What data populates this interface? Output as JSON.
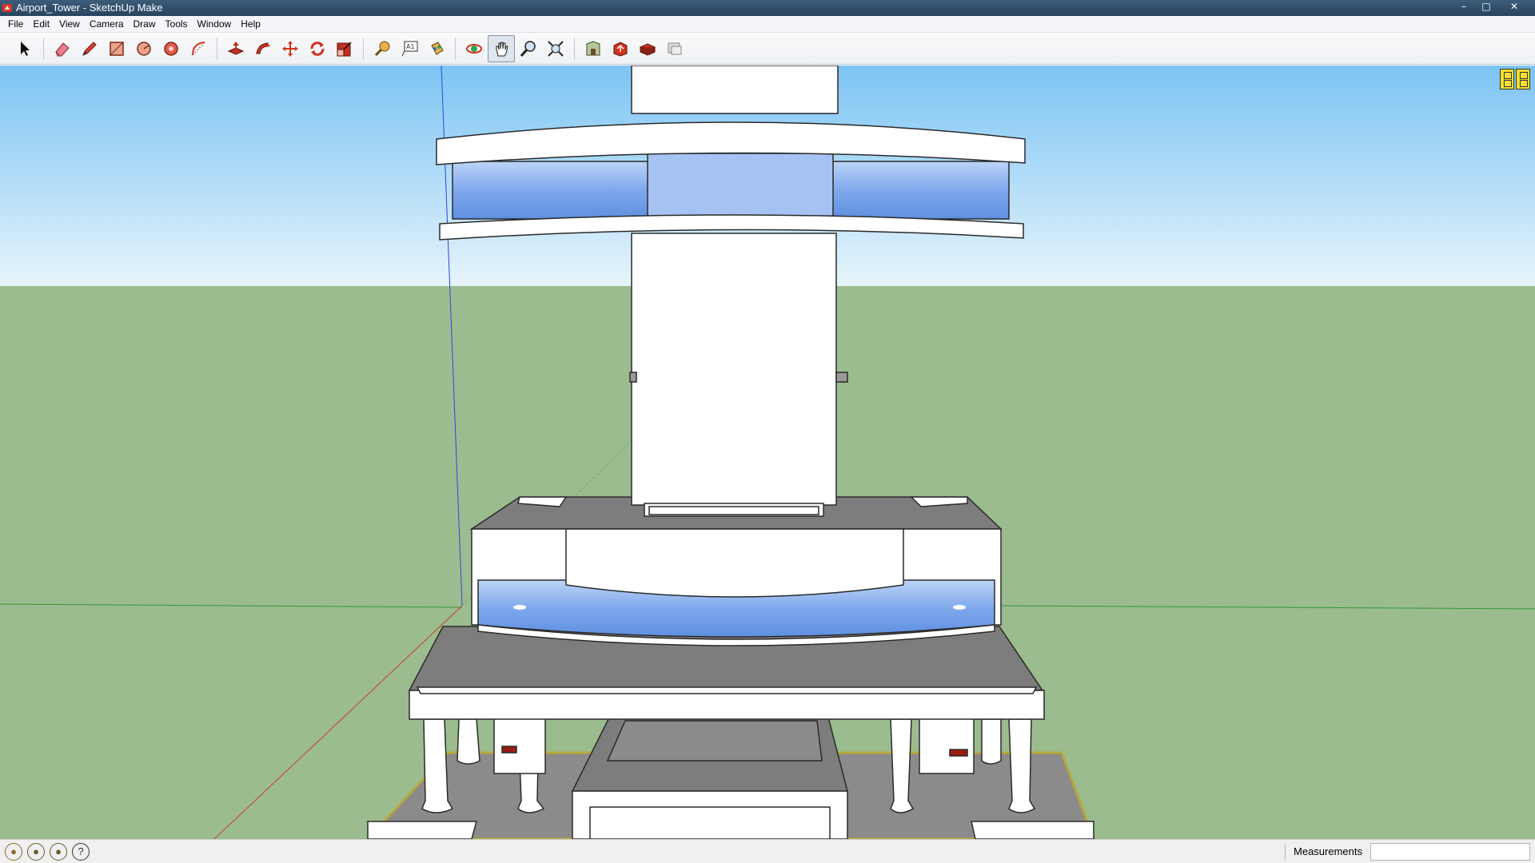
{
  "window": {
    "title": "Airport_Tower - SketchUp Make",
    "minimize": "–",
    "maximize": "□",
    "close": "✕"
  },
  "menu": [
    "File",
    "Edit",
    "View",
    "Camera",
    "Draw",
    "Tools",
    "Window",
    "Help"
  ],
  "toolbar": {
    "tools": [
      {
        "name": "select-tool",
        "icon": "arrow-icon"
      },
      {
        "name": "eraser-tool",
        "icon": "eraser-icon"
      },
      {
        "name": "line-tool",
        "icon": "pencil-icon"
      },
      {
        "name": "rectangle-tool",
        "icon": "rectangle-icon"
      },
      {
        "name": "circle-tool",
        "icon": "circle-icon"
      },
      {
        "name": "polygon-tool",
        "icon": "polygon-icon"
      },
      {
        "name": "arc-tool",
        "icon": "arc-icon"
      },
      {
        "name": "push-pull-tool",
        "icon": "push-pull-icon"
      },
      {
        "name": "follow-me-tool",
        "icon": "follow-me-icon"
      },
      {
        "name": "move-tool",
        "icon": "move-icon"
      },
      {
        "name": "rotate-tool",
        "icon": "rotate-icon"
      },
      {
        "name": "scale-tool",
        "icon": "scale-icon"
      },
      {
        "name": "tape-measure-tool",
        "icon": "tape-measure-icon"
      },
      {
        "name": "text-tool",
        "icon": "text-icon"
      },
      {
        "name": "paint-bucket-tool",
        "icon": "paint-bucket-icon"
      },
      {
        "name": "orbit-tool",
        "icon": "orbit-icon"
      },
      {
        "name": "pan-tool",
        "icon": "hand-icon",
        "active": true
      },
      {
        "name": "zoom-tool",
        "icon": "magnifier-icon"
      },
      {
        "name": "zoom-extents-tool",
        "icon": "zoom-extents-icon"
      },
      {
        "name": "3d-warehouse-button",
        "icon": "warehouse-icon"
      },
      {
        "name": "share-model-button",
        "icon": "share-icon"
      },
      {
        "name": "extension-warehouse-button",
        "icon": "extension-icon"
      },
      {
        "name": "layout-button",
        "icon": "layout-icon"
      }
    ]
  },
  "status": {
    "message": "",
    "measurements_label": "Measurements",
    "measurements_value": ""
  },
  "colors": {
    "sky_top": "#7cc4f4",
    "sky_bottom": "#e6f4fb",
    "ground": "#9bbc8f",
    "model_white": "#ffffff",
    "model_gray": "#7a7a7a",
    "glass": "#7fa8ec",
    "edge": "#2a2a2a"
  }
}
